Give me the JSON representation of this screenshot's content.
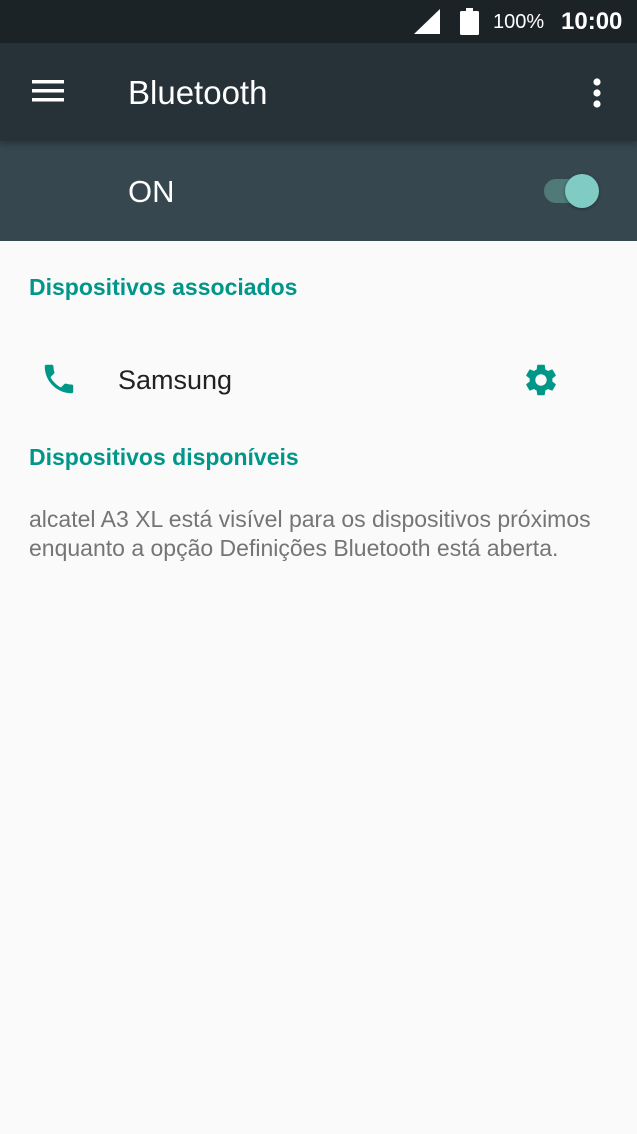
{
  "status_bar": {
    "battery_percent": "100%",
    "time": "10:00",
    "icons": [
      "signal-icon",
      "battery-icon"
    ]
  },
  "app_bar": {
    "title": "Bluetooth",
    "icons": [
      "menu-icon",
      "more-vert-icon"
    ]
  },
  "bluetooth_switch": {
    "label": "ON",
    "enabled": true
  },
  "paired_devices": {
    "header": "Dispositivos associados",
    "items": [
      {
        "name": "Samsung",
        "icon": "phone-icon",
        "action_icon": "gear-icon"
      }
    ]
  },
  "available_devices": {
    "header": "Dispositivos disponíveis",
    "message": "alcatel A3 XL está visível para os dispositivos próximos enquanto a opção Definições Bluetooth está aberta."
  },
  "colors": {
    "accent": "#009688",
    "app_bar": "#263238",
    "switch_bar": "#37474f",
    "status_bar": "#1c2327",
    "toggle_thumb": "#80cbc4",
    "background": "#fafafa"
  }
}
